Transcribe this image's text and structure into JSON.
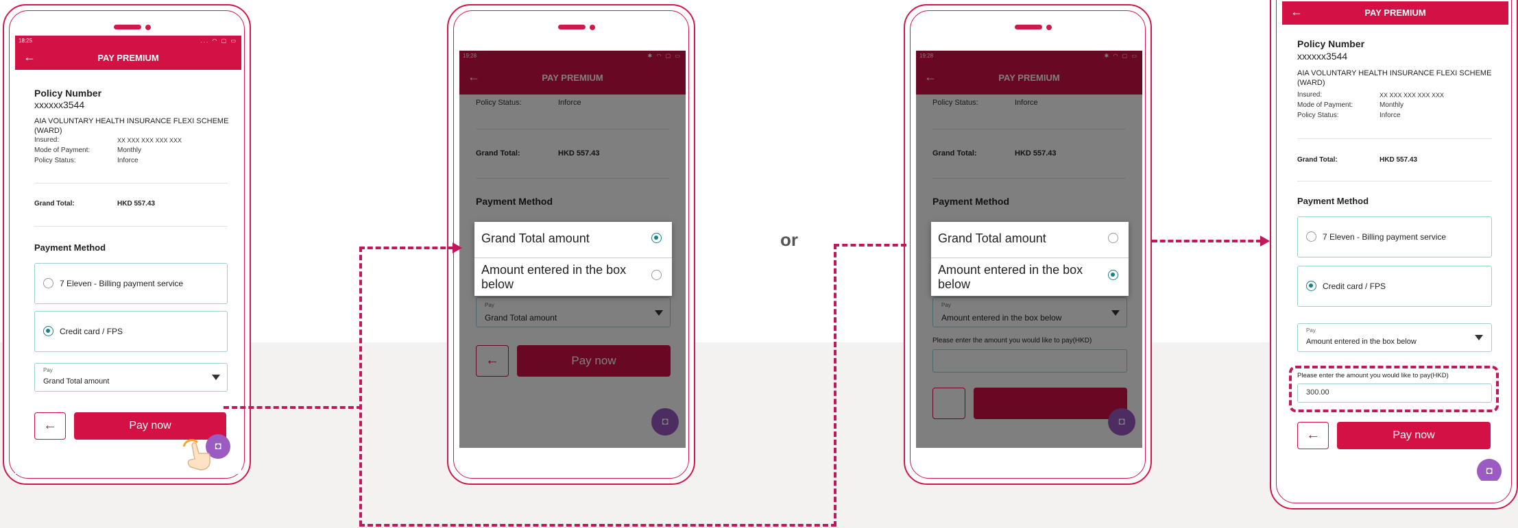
{
  "app_title": "PAY PREMIUM",
  "status_time_1": "18:25",
  "status_time_2": "19:28",
  "policy": {
    "number_label": "Policy Number",
    "number_value": "xxxxxx3544",
    "plan_name": "AIA VOLUNTARY HEALTH INSURANCE FLEXI SCHEME (WARD)",
    "insured_label": "Insured:",
    "insured_value": "XX XXX XXX XXX XXX",
    "mode_label": "Mode of Payment:",
    "mode_value": "Monthly",
    "status_label": "Policy Status:",
    "status_value": "Inforce"
  },
  "grand_total_label": "Grand Total:",
  "grand_total_value": "HKD 557.43",
  "payment_method_label": "Payment Method",
  "option_seven_eleven": "7 Eleven - Billing payment service",
  "option_credit_card": "Credit card / FPS",
  "pay_select_label": "Pay",
  "pay_select_grand": "Grand Total amount",
  "pay_select_amount": "Amount entered in the box below",
  "pay_now": "Pay now",
  "amount_prompt": "Please enter the amount you would like to pay(HKD)",
  "amount_value": "300.00",
  "dialog_options": [
    "Grand Total amount",
    "Amount entered in the box below"
  ],
  "or_text": "or",
  "colors": {
    "brand": "#d31145",
    "accent_dash": "#c2185b",
    "radio": "#1a7f8a",
    "card_border": "#9bd0d0",
    "bot": "#9b5bc3"
  },
  "icons": {
    "back": "arrow-left-icon",
    "dropdown": "caret-down-icon",
    "chatbot": "chatbot-icon",
    "hand": "tap-hand-icon"
  }
}
